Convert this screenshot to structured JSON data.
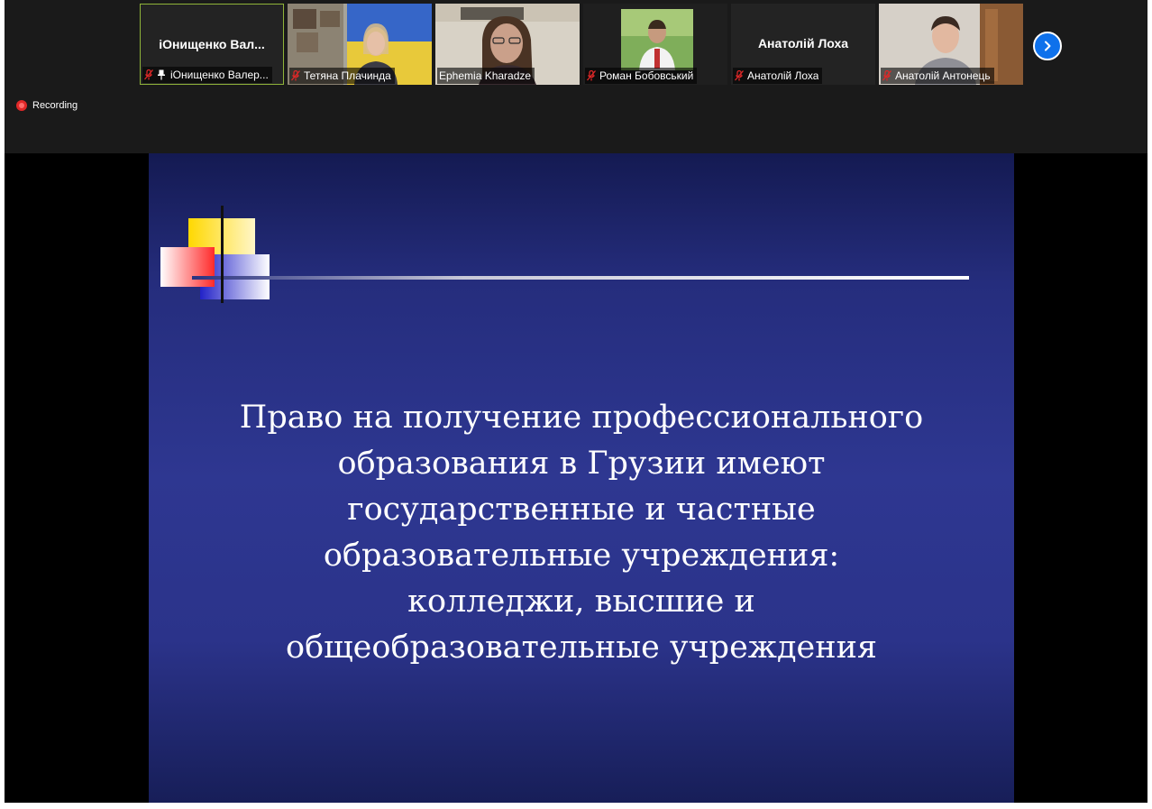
{
  "meeting": {
    "recording_label": "Recording",
    "next_icon": "chevron-right-icon",
    "participants": [
      {
        "display_name": "іОнищенко  Вал...",
        "tag": "іОнищенко Валер...",
        "muted": true,
        "pinned": true,
        "video": false,
        "active": true
      },
      {
        "display_name": "",
        "tag": "Тетяна Плачинда",
        "muted": true,
        "pinned": false,
        "video": true,
        "active": false
      },
      {
        "display_name": "",
        "tag": "Ephemia Kharadze",
        "muted": false,
        "pinned": false,
        "video": true,
        "active": false
      },
      {
        "display_name": "",
        "tag": "Роман Бобовський",
        "muted": true,
        "pinned": false,
        "video": true,
        "active": false
      },
      {
        "display_name": "Анатолій Лоха",
        "tag": "Анатолій Лоха",
        "muted": true,
        "pinned": false,
        "video": false,
        "active": false
      },
      {
        "display_name": "",
        "tag": "Анатолій Антонець",
        "muted": true,
        "pinned": false,
        "video": true,
        "active": false
      }
    ]
  },
  "slide": {
    "text": "Право на получение профессионального\nобразования в Грузии имеют\nгосударственные и частные\nобразовательные учреждения:\nколледжи, высшие и\nобщеобразовательные учреждения",
    "colors": {
      "background": "#2e3791",
      "yellow": "#ffd800",
      "red": "#ff3b3b",
      "blue": "#2a2ad6"
    }
  }
}
